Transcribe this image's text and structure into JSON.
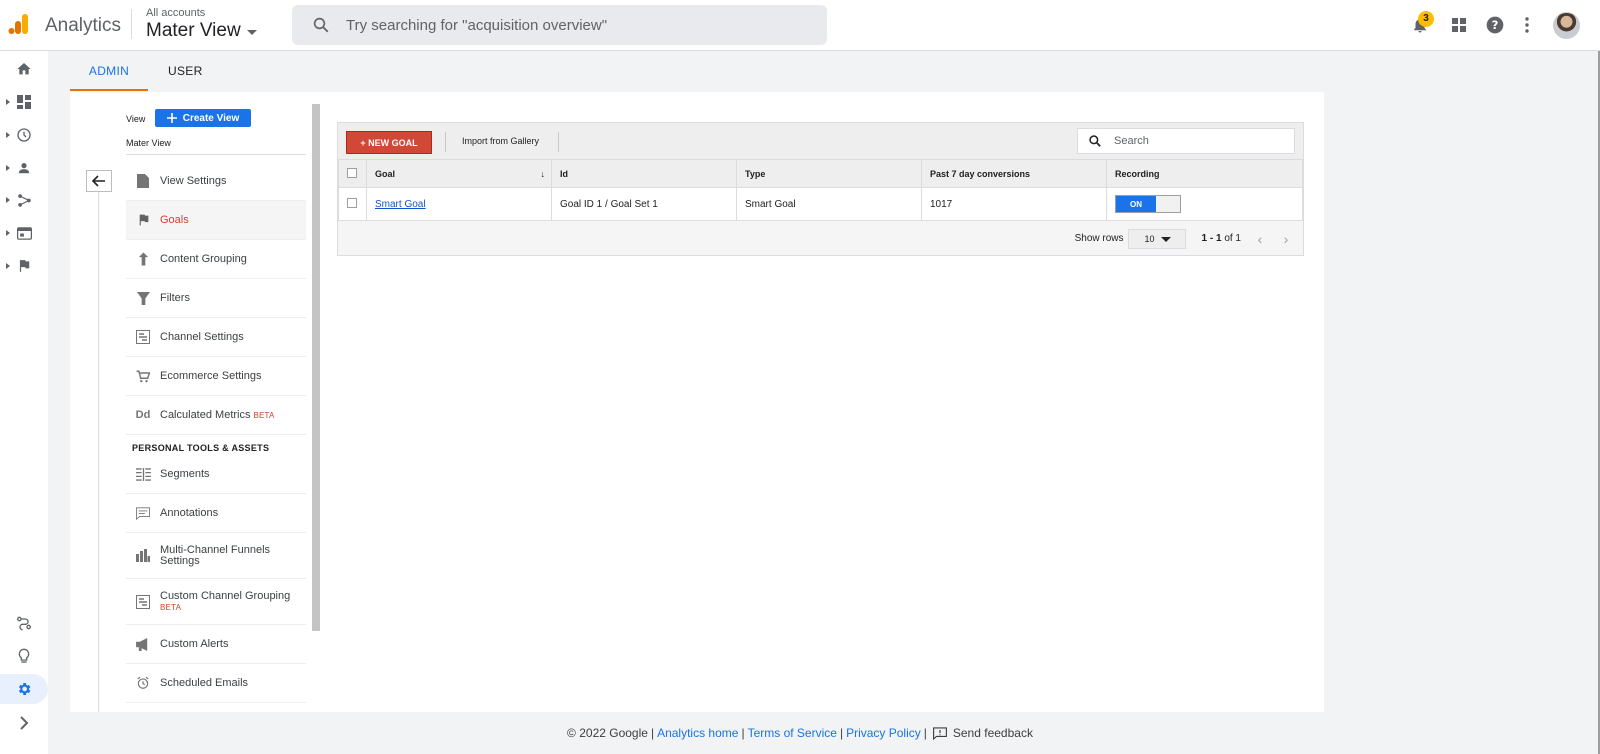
{
  "app": {
    "name": "Analytics"
  },
  "account": {
    "label": "All accounts",
    "view": "Mater View"
  },
  "search": {
    "placeholder": "Try searching for \"acquisition overview\""
  },
  "notifications": {
    "count": "3"
  },
  "tabs": [
    {
      "label": "ADMIN"
    },
    {
      "label": "USER"
    }
  ],
  "sidebar": {
    "view_label": "View",
    "create_view": "Create View",
    "view_name": "Mater View",
    "items": [
      {
        "label": "View Settings",
        "icon": "document-icon"
      },
      {
        "label": "Goals",
        "icon": "flag-icon"
      },
      {
        "label": "Content Grouping",
        "icon": "content-grouping-icon"
      },
      {
        "label": "Filters",
        "icon": "filter-icon"
      },
      {
        "label": "Channel Settings",
        "icon": "channel-icon"
      },
      {
        "label": "Ecommerce Settings",
        "icon": "cart-icon"
      },
      {
        "label": "Calculated Metrics",
        "badge": "BETA",
        "icon": "calculated-metrics-icon"
      }
    ],
    "section_title": "PERSONAL TOOLS & ASSETS",
    "tools": [
      {
        "label": "Segments",
        "icon": "segments-icon"
      },
      {
        "label": "Annotations",
        "icon": "annotation-icon"
      },
      {
        "label": "Multi-Channel Funnels Settings",
        "icon": "bar-chart-icon"
      },
      {
        "label": "Custom Channel Grouping",
        "badge": "BETA",
        "icon": "channel-icon"
      },
      {
        "label": "Custom Alerts",
        "icon": "megaphone-icon"
      },
      {
        "label": "Scheduled Emails",
        "icon": "alarm-icon"
      }
    ]
  },
  "goals": {
    "new_goal": "+ NEW GOAL",
    "import": "Import from Gallery",
    "search_placeholder": "Search",
    "columns": [
      "Goal",
      "Id",
      "Type",
      "Past 7 day conversions",
      "Recording"
    ],
    "rows": [
      {
        "goal": "Smart Goal",
        "id": "Goal ID 1 / Goal Set 1",
        "type": "Smart Goal",
        "conversions": "1017",
        "recording": "ON"
      }
    ],
    "show_rows_label": "Show rows",
    "rows_value": "10",
    "page_range": "1 - 1",
    "page_of": "of 1"
  },
  "footer": {
    "copyright": "© 2022 Google",
    "analytics_home": "Analytics home",
    "terms": "Terms of Service",
    "privacy": "Privacy Policy",
    "feedback": "Send feedback"
  },
  "colors": {
    "accent": "#1a73e8",
    "new_goal": "#d14836",
    "active_tab_underline": "#e8710a"
  }
}
